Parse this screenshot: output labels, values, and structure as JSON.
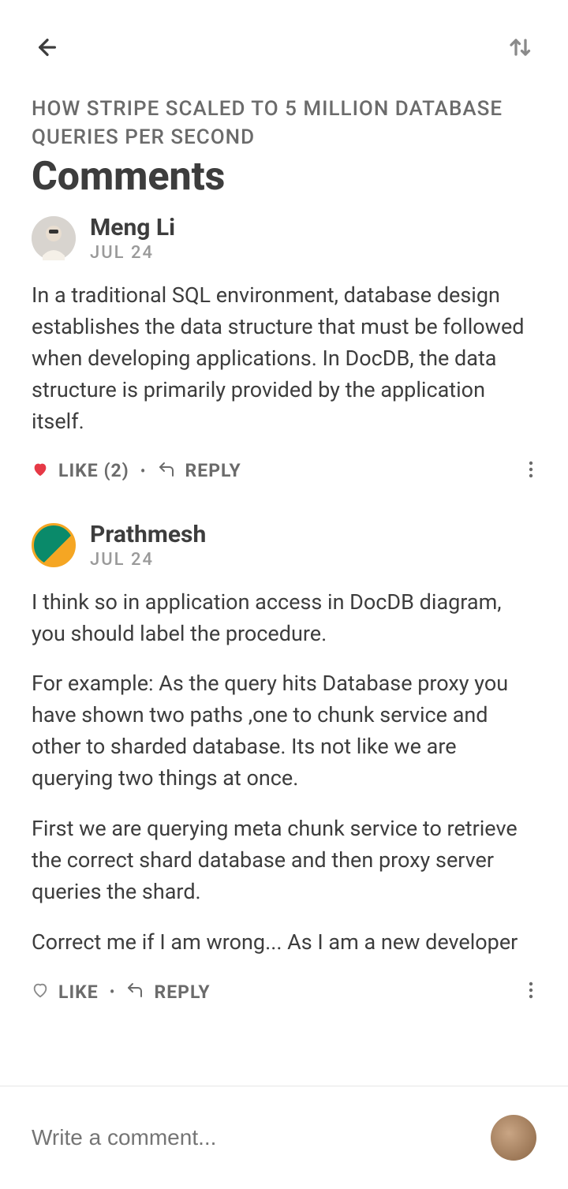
{
  "article": {
    "title": "HOW STRIPE SCALED TO 5 MILLION DATABASE QUERIES PER SECOND"
  },
  "pageTitle": "Comments",
  "comments": [
    {
      "author": "Meng Li",
      "date": "JUL 24",
      "body": [
        "In a traditional SQL environment, database design establishes the data structure that must be followed when developing applications. In DocDB, the data structure is primarily provided by the application itself."
      ],
      "liked": true,
      "likeLabel": "LIKE (2)",
      "replyLabel": "REPLY"
    },
    {
      "author": "Prathmesh",
      "date": "JUL 24",
      "body": [
        "I think so in application access in DocDB diagram, you should label the procedure.",
        "For example: As the query hits Database proxy you have shown two paths ,one to chunk service and other to sharded database. Its not like we are querying two things at once.",
        "First we are querying meta chunk service to retrieve the correct shard database and then proxy server queries the shard.",
        "Correct me if I am wrong... As I am a new developer"
      ],
      "liked": false,
      "likeLabel": "LIKE",
      "replyLabel": "REPLY"
    }
  ],
  "composer": {
    "placeholder": "Write a comment..."
  }
}
